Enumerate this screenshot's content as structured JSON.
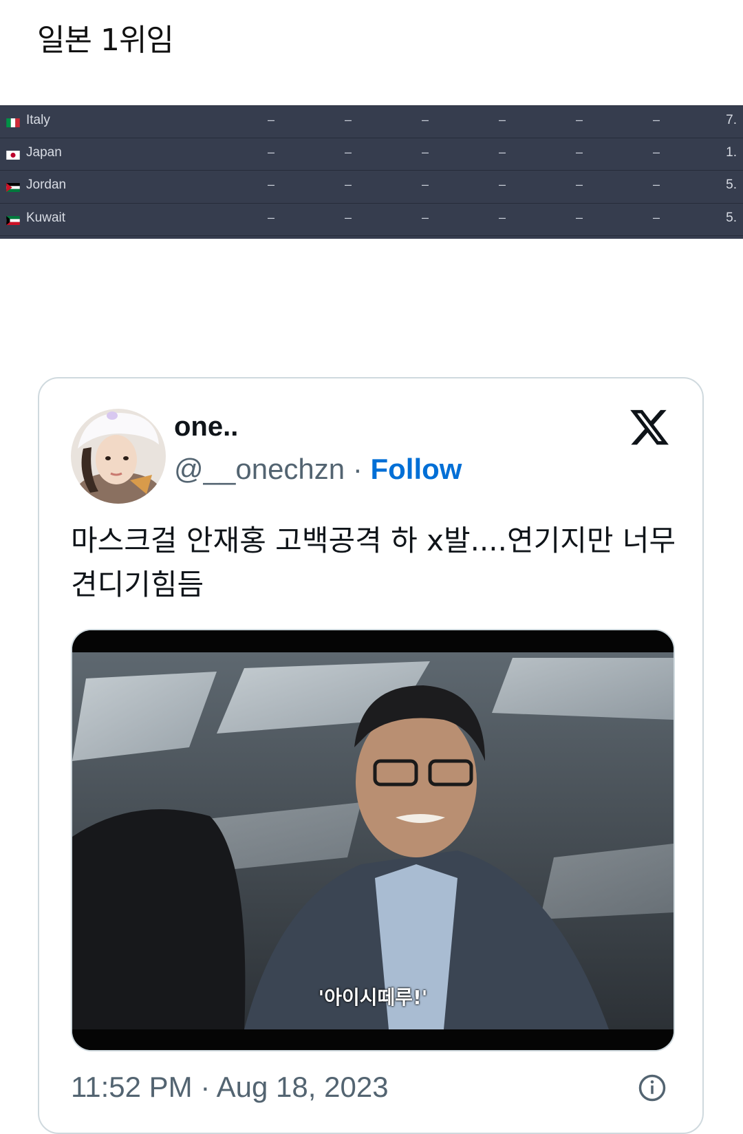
{
  "post": {
    "title": "일본 1위임"
  },
  "ranking_table": {
    "rows": [
      {
        "country": "Italy",
        "flag": "italy-flag",
        "cells": [
          "–",
          "–",
          "–",
          "–",
          "–",
          "–"
        ],
        "value": "7."
      },
      {
        "country": "Japan",
        "flag": "japan-flag",
        "cells": [
          "–",
          "–",
          "–",
          "–",
          "–",
          "–"
        ],
        "value": "1."
      },
      {
        "country": "Jordan",
        "flag": "jordan-flag",
        "cells": [
          "–",
          "–",
          "–",
          "–",
          "–",
          "–"
        ],
        "value": "5."
      },
      {
        "country": "Kuwait",
        "flag": "kuwait-flag",
        "cells": [
          "–",
          "–",
          "–",
          "–",
          "–",
          "–"
        ],
        "value": "5."
      }
    ]
  },
  "tweet": {
    "display_name": "one..",
    "handle": "@__onechzn",
    "separator": " · ",
    "follow_label": "Follow",
    "text": "마스크걸 안재홍 고백공격 하 x발....연기지만 너무 견디기힘듬",
    "media": {
      "subtitle": "'아이시떼루!'"
    },
    "timestamp": "11:52 PM · Aug 18, 2023",
    "icons": [
      "x-logo-icon",
      "info-icon"
    ]
  },
  "colors": {
    "table_bg": "#363d4e",
    "follow": "#006fd6",
    "muted_text": "#536471",
    "card_border": "#cfd9de"
  }
}
